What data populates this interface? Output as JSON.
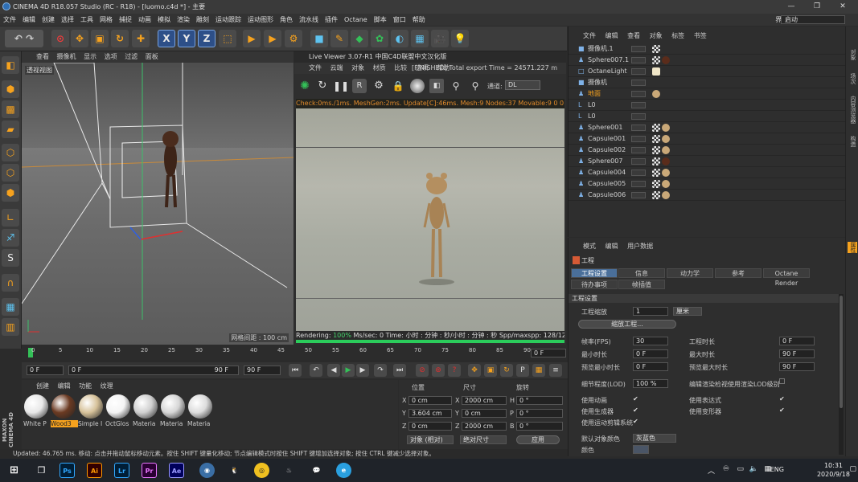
{
  "window": {
    "title": "CINEMA 4D R18.057 Studio (RC - R18) - [luomo.c4d *] - 主要",
    "minimize": "—",
    "maximize": "❐",
    "close": "✕"
  },
  "menubar": {
    "items": [
      "文件",
      "编辑",
      "创建",
      "选择",
      "工具",
      "网格",
      "捕捉",
      "动画",
      "模拟",
      "渲染",
      "雕刻",
      "运动跟踪",
      "运动图形",
      "角色",
      "流水线",
      "插件",
      "Octane",
      "脚本",
      "窗口",
      "帮助"
    ],
    "layout_label": "界面:",
    "layout_value": "启动"
  },
  "toolbar": {
    "axis_x": "X",
    "axis_y": "Y",
    "axis_z": "Z"
  },
  "viewport": {
    "menu": [
      "查看",
      "摄像机",
      "显示",
      "选项",
      "过滤",
      "面板"
    ],
    "label": "透视视图",
    "grid": "网格间距 : 100 cm"
  },
  "live_viewer": {
    "title": "Live Viewer 3.07-R1 中国C4D联盟中文汉化版",
    "menu": [
      "文件",
      "云端",
      "对象",
      "材质",
      "比较",
      "选项",
      "帮助"
    ],
    "status_top": "[FINISHED] Total export Time = 24571.227 m",
    "channel_label": "通道:",
    "channel_value": "DL",
    "check_line": "Check:0ms./1ms. MeshGen:2ms. Update[C]:46ms. Mesh:9 Nodes:37 Movable:9  0 0",
    "rendering_label": "Rendering: ",
    "rendering_value": "100%",
    "render_rest": "  Ms/sec: 0   Time: 小时 : 分钟 : 秒/小时 : 分钟 : 秒   Spp/maxspp: 128/128    Tri: 0/8k"
  },
  "object_manager": {
    "menu": [
      "文件",
      "编辑",
      "查看",
      "对象",
      "标签",
      "书签"
    ],
    "objects": [
      {
        "name": "摄像机.1",
        "icon": "camera-icon",
        "tags": [
          "check"
        ]
      },
      {
        "name": "Sphere007.1",
        "icon": "sphere-icon",
        "tags": [
          "check",
          "dark"
        ]
      },
      {
        "name": "OctaneLight",
        "icon": "light-icon",
        "tags": [
          "light"
        ]
      },
      {
        "name": "摄像机",
        "icon": "camera-icon",
        "tags": []
      },
      {
        "name": "地面",
        "icon": "floor-icon",
        "tags": [
          "wood"
        ],
        "active": true
      },
      {
        "name": "L0",
        "icon": "null-icon",
        "tags": []
      },
      {
        "name": "L0",
        "icon": "null-icon",
        "tags": []
      },
      {
        "name": "Sphere001",
        "icon": "sphere-icon",
        "tags": [
          "check",
          "wood"
        ]
      },
      {
        "name": "Capsule001",
        "icon": "capsule-icon",
        "tags": [
          "check",
          "wood"
        ]
      },
      {
        "name": "Capsule002",
        "icon": "capsule-icon",
        "tags": [
          "check",
          "wood"
        ]
      },
      {
        "name": "Sphere007",
        "icon": "sphere-icon",
        "tags": [
          "check",
          "dark"
        ]
      },
      {
        "name": "Capsule004",
        "icon": "capsule-icon",
        "tags": [
          "check",
          "wood"
        ]
      },
      {
        "name": "Capsule005",
        "icon": "capsule-icon",
        "tags": [
          "check",
          "wood"
        ]
      },
      {
        "name": "Capsule006",
        "icon": "capsule-icon",
        "tags": [
          "check",
          "wood"
        ]
      }
    ]
  },
  "right_strip": {
    "tabs": [
      "对象",
      "场次",
      "内容浏览器",
      "构造"
    ],
    "attr_tab": "属性"
  },
  "attributes": {
    "menu": [
      "模式",
      "编辑",
      "用户数据"
    ],
    "title": "工程",
    "tabs_row1": [
      "工程设置",
      "信息",
      "动力学",
      "参考",
      "Octane Render"
    ],
    "tabs_row2": [
      "待办事项",
      "帧插值"
    ],
    "section": "工程设置",
    "scale_label": "工程缩放",
    "scale_value": "1",
    "scale_unit": "厘米",
    "scale_button": "缩放工程...",
    "fps_label": "帧率(FPS)",
    "fps_value": "30",
    "proj_time_label": "工程时长",
    "proj_time_value": "0 F",
    "min_time_label": "最小时长",
    "min_time_value": "0 F",
    "max_time_label": "最大时长",
    "max_time_value": "90 F",
    "preview_min_label": "预览最小时长",
    "preview_min_value": "0 F",
    "preview_max_label": "预览最大时长",
    "preview_max_value": "90 F",
    "lod_label": "细节程度(LOD)",
    "lod_value": "100 %",
    "lod_render_label": "编辑渲染检视使用渲染LOD级别",
    "use_anim": "使用动画",
    "use_expr": "使用表达式",
    "use_gen": "使用生成器",
    "use_deform": "使用变形器",
    "use_motion": "使用运动剪辑系统",
    "default_color_label": "默认对象颜色",
    "default_color_value": "灰蓝色",
    "color_label": "颜色",
    "check_mark": "✔"
  },
  "timeline": {
    "ticks": [
      "0",
      "5",
      "10",
      "15",
      "20",
      "25",
      "30",
      "35",
      "40",
      "45",
      "50",
      "55",
      "60",
      "65",
      "70",
      "75",
      "80",
      "85",
      "90"
    ],
    "current_frame": "0 F"
  },
  "playback": {
    "start": "0 F",
    "range_start": "0 F",
    "range_end": "90 F",
    "end": "90 F"
  },
  "materials": {
    "menu": [
      "创建",
      "编辑",
      "功能",
      "纹理"
    ],
    "items": [
      {
        "name": "White P",
        "color": "#e8e8e8"
      },
      {
        "name": "Wood3",
        "color": "#6b3a22",
        "selected": true
      },
      {
        "name": "Simple I",
        "color": "#d7c29a"
      },
      {
        "name": "OctGlos",
        "color": "#f4f4f4"
      },
      {
        "name": "Materia",
        "color": "#d0d0d0"
      },
      {
        "name": "Materia",
        "color": "#d6d6d6"
      },
      {
        "name": "Materia",
        "color": "#dcdcdc"
      }
    ]
  },
  "coordinates": {
    "headers": [
      "位置",
      "尺寸",
      "旋转"
    ],
    "x_pos": "0 cm",
    "x_size": "2000 cm",
    "h_rot": "0 °",
    "y_pos": "3.604 cm",
    "y_size": "0 cm",
    "p_rot": "0 °",
    "z_pos": "0 cm",
    "z_size": "2000 cm",
    "b_rot": "0 °",
    "x": "X",
    "y": "Y",
    "z": "Z",
    "h": "H",
    "p": "P",
    "b": "B",
    "mode": "对象 (相对)",
    "size_mode": "绝对尺寸",
    "apply": "应用"
  },
  "status": {
    "text": "Updated: 46.765 ms.    移动: 点击并拖动鼠标移动元素。按住 SHIFT 键量化移动; 节点编辑模式时按住 SHIFT 键增加选择对象; 按住 CTRL 键减少选择对象。"
  },
  "brand": {
    "maxon": "MAXON CINEMA 4D"
  },
  "taskbar": {
    "apps": [
      {
        "name": "Ps",
        "color": "#31a8ff",
        "bg": "#001e36"
      },
      {
        "name": "Ai",
        "color": "#ff9a00",
        "bg": "#330000"
      },
      {
        "name": "Lr",
        "color": "#31a8ff",
        "bg": "#001e36"
      },
      {
        "name": "Pr",
        "color": "#ea77ff",
        "bg": "#2a0033"
      },
      {
        "name": "Ae",
        "color": "#9999ff",
        "bg": "#00005b"
      }
    ],
    "lang": "ENG",
    "time": "10:31",
    "date": "2020/9/18"
  }
}
